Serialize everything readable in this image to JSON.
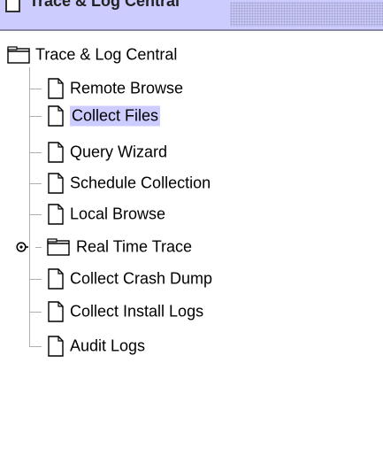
{
  "window": {
    "title": "Trace & Log Central"
  },
  "tree": {
    "root": {
      "label": "Trace & Log Central",
      "icon": "folder-icon"
    },
    "items": [
      {
        "label": "Remote Browse",
        "icon": "document-icon",
        "selected": false
      },
      {
        "label": "Collect Files",
        "icon": "document-icon",
        "selected": true
      },
      {
        "label": "Query Wizard",
        "icon": "document-icon",
        "selected": false
      },
      {
        "label": "Schedule Collection",
        "icon": "document-icon",
        "selected": false
      },
      {
        "label": "Local Browse",
        "icon": "document-icon",
        "selected": false
      },
      {
        "label": "Real Time Trace",
        "icon": "folder-icon",
        "selected": false,
        "collapsed": true
      },
      {
        "label": "Collect Crash Dump",
        "icon": "document-icon",
        "selected": false
      },
      {
        "label": "Collect Install Logs",
        "icon": "document-icon",
        "selected": false
      },
      {
        "label": "Audit Logs",
        "icon": "document-icon",
        "selected": false
      }
    ]
  },
  "colors": {
    "titlebar": "#ccccff",
    "selection": "#ccccff",
    "tree_line": "#b0b0b0"
  }
}
